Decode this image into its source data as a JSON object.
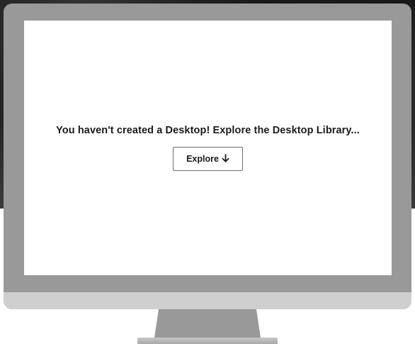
{
  "empty_state": {
    "message": "You haven't created a Desktop! Explore the Desktop Library...",
    "explore_button": {
      "label": "Explore",
      "icon": "arrow-down-icon"
    }
  },
  "colors": {
    "bezel": "#999999",
    "chin": "#cfcfcf",
    "screen": "#ffffff",
    "text": "#1a1a1a",
    "button_border": "#6e6e6e"
  }
}
